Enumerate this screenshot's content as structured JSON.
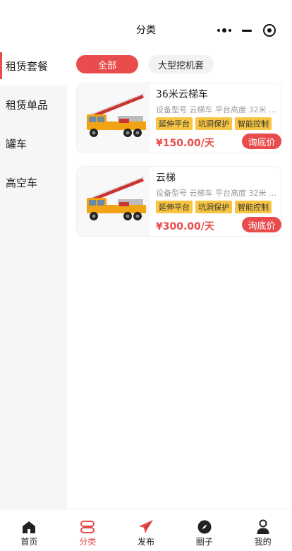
{
  "header": {
    "title": "分类"
  },
  "sidebar": {
    "items": [
      {
        "label": "租赁套餐"
      },
      {
        "label": "租赁单品"
      },
      {
        "label": "罐车"
      },
      {
        "label": "高空车"
      }
    ],
    "active_index": 0
  },
  "filters": {
    "pills": [
      {
        "label": "全部"
      },
      {
        "label": "大型挖机套"
      }
    ],
    "active_index": 0
  },
  "products": [
    {
      "title": "36米云梯车",
      "spec": "设备型号 云梯车 平台高度 32米 专...",
      "tags": [
        "延伸平台",
        "坑洞保护",
        "智能控制"
      ],
      "price": "¥150.00/天",
      "action": "询底价"
    },
    {
      "title": "云梯",
      "spec": "设备型号 云梯车 平台高度 32米 专...",
      "tags": [
        "延伸平台",
        "坑洞保护",
        "智能控制"
      ],
      "price": "¥300.00/天",
      "action": "询底价"
    }
  ],
  "tabbar": {
    "items": [
      {
        "label": "首页",
        "icon": "home-icon"
      },
      {
        "label": "分类",
        "icon": "category-icon"
      },
      {
        "label": "发布",
        "icon": "paper-plane-icon"
      },
      {
        "label": "圈子",
        "icon": "compass-icon"
      },
      {
        "label": "我的",
        "icon": "user-icon"
      }
    ],
    "active_index": 1
  },
  "colors": {
    "accent": "#e84c4c",
    "tag": "#f7c543",
    "sidebar_bg": "#f6f6f6"
  }
}
